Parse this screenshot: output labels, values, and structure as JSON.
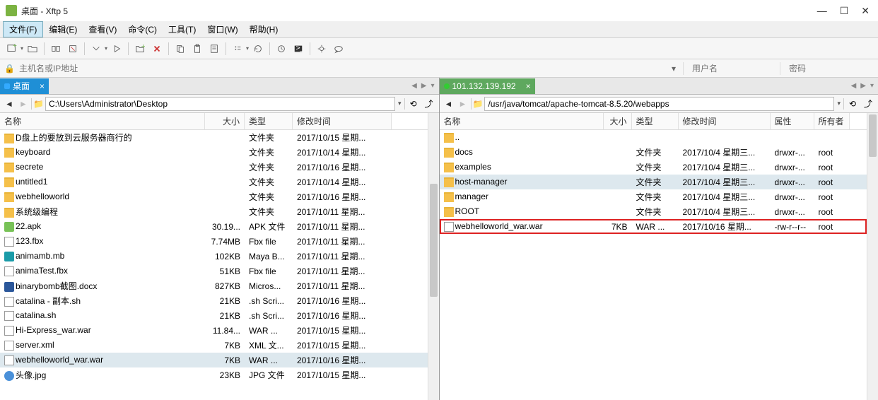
{
  "window": {
    "title": "桌面 - Xftp 5"
  },
  "menu": [
    "文件(F)",
    "编辑(E)",
    "查看(V)",
    "命令(C)",
    "工具(T)",
    "窗口(W)",
    "帮助(H)"
  ],
  "addressbar": {
    "host_placeholder": "主机名或IP地址",
    "user_placeholder": "用户名",
    "pass_placeholder": "密码"
  },
  "left": {
    "tab": "桌面",
    "path": "C:\\Users\\Administrator\\Desktop",
    "columns": {
      "name": "名称",
      "size": "大小",
      "type": "类型",
      "date": "修改时间"
    },
    "rows": [
      {
        "ico": "folder",
        "name": "D盘上的要放到云服务器商行的",
        "size": "",
        "type": "文件夹",
        "date": "2017/10/15 星期..."
      },
      {
        "ico": "folder",
        "name": "keyboard",
        "size": "",
        "type": "文件夹",
        "date": "2017/10/14 星期..."
      },
      {
        "ico": "folder",
        "name": "secrete",
        "size": "",
        "type": "文件夹",
        "date": "2017/10/16 星期..."
      },
      {
        "ico": "folder",
        "name": "untitled1",
        "size": "",
        "type": "文件夹",
        "date": "2017/10/14 星期..."
      },
      {
        "ico": "folder",
        "name": "webhelloworld",
        "size": "",
        "type": "文件夹",
        "date": "2017/10/16 星期..."
      },
      {
        "ico": "folder",
        "name": "系统级编程",
        "size": "",
        "type": "文件夹",
        "date": "2017/10/11 星期..."
      },
      {
        "ico": "apk",
        "name": "22.apk",
        "size": "30.19...",
        "type": "APK 文件",
        "date": "2017/10/11 星期..."
      },
      {
        "ico": "file",
        "name": "123.fbx",
        "size": "7.74MB",
        "type": "Fbx file",
        "date": "2017/10/11 星期..."
      },
      {
        "ico": "maya",
        "name": "animamb.mb",
        "size": "102KB",
        "type": "Maya B...",
        "date": "2017/10/11 星期..."
      },
      {
        "ico": "file",
        "name": "animaTest.fbx",
        "size": "51KB",
        "type": "Fbx file",
        "date": "2017/10/11 星期..."
      },
      {
        "ico": "word",
        "name": "binarybomb截图.docx",
        "size": "827KB",
        "type": "Micros...",
        "date": "2017/10/11 星期..."
      },
      {
        "ico": "file",
        "name": "catalina - 副本.sh",
        "size": "21KB",
        "type": ".sh Scri...",
        "date": "2017/10/16 星期..."
      },
      {
        "ico": "file",
        "name": "catalina.sh",
        "size": "21KB",
        "type": ".sh Scri...",
        "date": "2017/10/16 星期..."
      },
      {
        "ico": "file",
        "name": "Hi-Express_war.war",
        "size": "11.84...",
        "type": "WAR ...",
        "date": "2017/10/15 星期..."
      },
      {
        "ico": "file",
        "name": "server.xml",
        "size": "7KB",
        "type": "XML 文...",
        "date": "2017/10/15 星期..."
      },
      {
        "ico": "file",
        "name": "webhelloworld_war.war",
        "size": "7KB",
        "type": "WAR ...",
        "date": "2017/10/16 星期...",
        "selected": true
      },
      {
        "ico": "img",
        "name": "头像.jpg",
        "size": "23KB",
        "type": "JPG 文件",
        "date": "2017/10/15 星期..."
      }
    ]
  },
  "right": {
    "tab": "101.132.139.192",
    "path": "/usr/java/tomcat/apache-tomcat-8.5.20/webapps",
    "columns": {
      "name": "名称",
      "size": "大小",
      "type": "类型",
      "date": "修改时间",
      "attr": "属性",
      "owner": "所有者"
    },
    "rows": [
      {
        "ico": "folder",
        "name": "..",
        "size": "",
        "type": "",
        "date": "",
        "attr": "",
        "owner": ""
      },
      {
        "ico": "folder",
        "name": "docs",
        "size": "",
        "type": "文件夹",
        "date": "2017/10/4 星期三...",
        "attr": "drwxr-...",
        "owner": "root"
      },
      {
        "ico": "folder",
        "name": "examples",
        "size": "",
        "type": "文件夹",
        "date": "2017/10/4 星期三...",
        "attr": "drwxr-...",
        "owner": "root"
      },
      {
        "ico": "folder",
        "name": "host-manager",
        "size": "",
        "type": "文件夹",
        "date": "2017/10/4 星期三...",
        "attr": "drwxr-...",
        "owner": "root",
        "selected": true
      },
      {
        "ico": "folder",
        "name": "manager",
        "size": "",
        "type": "文件夹",
        "date": "2017/10/4 星期三...",
        "attr": "drwxr-...",
        "owner": "root"
      },
      {
        "ico": "folder",
        "name": "ROOT",
        "size": "",
        "type": "文件夹",
        "date": "2017/10/4 星期三...",
        "attr": "drwxr-...",
        "owner": "root"
      },
      {
        "ico": "file",
        "name": "webhelloworld_war.war",
        "size": "7KB",
        "type": "WAR ...",
        "date": "2017/10/16 星期...",
        "attr": "-rw-r--r--",
        "owner": "root",
        "highlighted": true
      }
    ]
  }
}
